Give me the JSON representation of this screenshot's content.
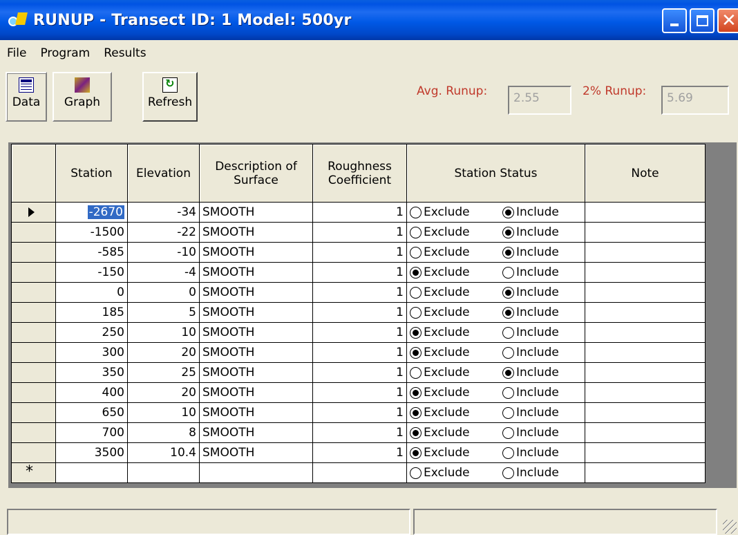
{
  "window": {
    "title": "RUNUP - Transect ID: 1 Model: 500yr"
  },
  "menu": [
    "File",
    "Program",
    "Results"
  ],
  "toolbar": {
    "data_label": "Data",
    "graph_label": "Graph",
    "refresh_label": "Refresh"
  },
  "runup": {
    "avg_label": "Avg. Runup:",
    "avg_value": "2.55",
    "two_pct_label": "2% Runup:",
    "two_pct_value": "5.69"
  },
  "grid": {
    "columns": [
      "Station",
      "Elevation",
      "Description of Surface",
      "Roughness Coefficient",
      "Station Status",
      "Note"
    ],
    "status_options": [
      "Exclude",
      "Include"
    ],
    "rows": [
      {
        "station": "-2670",
        "elevation": "-34",
        "surface": "SMOOTH",
        "roughness": "1",
        "status": "Include"
      },
      {
        "station": "-1500",
        "elevation": "-22",
        "surface": "SMOOTH",
        "roughness": "1",
        "status": "Include"
      },
      {
        "station": "-585",
        "elevation": "-10",
        "surface": "SMOOTH",
        "roughness": "1",
        "status": "Include"
      },
      {
        "station": "-150",
        "elevation": "-4",
        "surface": "SMOOTH",
        "roughness": "1",
        "status": "Exclude"
      },
      {
        "station": "0",
        "elevation": "0",
        "surface": "SMOOTH",
        "roughness": "1",
        "status": "Include"
      },
      {
        "station": "185",
        "elevation": "5",
        "surface": "SMOOTH",
        "roughness": "1",
        "status": "Include"
      },
      {
        "station": "250",
        "elevation": "10",
        "surface": "SMOOTH",
        "roughness": "1",
        "status": "Exclude"
      },
      {
        "station": "300",
        "elevation": "20",
        "surface": "SMOOTH",
        "roughness": "1",
        "status": "Exclude"
      },
      {
        "station": "350",
        "elevation": "25",
        "surface": "SMOOTH",
        "roughness": "1",
        "status": "Include"
      },
      {
        "station": "400",
        "elevation": "20",
        "surface": "SMOOTH",
        "roughness": "1",
        "status": "Exclude"
      },
      {
        "station": "650",
        "elevation": "10",
        "surface": "SMOOTH",
        "roughness": "1",
        "status": "Exclude"
      },
      {
        "station": "700",
        "elevation": "8",
        "surface": "SMOOTH",
        "roughness": "1",
        "status": "Exclude"
      },
      {
        "station": "3500",
        "elevation": "10.4",
        "surface": "SMOOTH",
        "roughness": "1",
        "status": "Exclude"
      }
    ],
    "new_row": {
      "station": "",
      "elevation": "",
      "surface": "",
      "roughness": "",
      "status": ""
    }
  },
  "colors": {
    "titlebar": "#0054e3",
    "runup_label": "#c0392b",
    "selection": "#316ac5",
    "face": "#ece9d8"
  },
  "icons": [
    "app-icon",
    "minimize-icon",
    "maximize-icon",
    "close-icon",
    "data-grid-icon",
    "graph-icon",
    "refresh-icon",
    "row-pointer-icon",
    "new-row-icon",
    "size-grip-icon"
  ]
}
